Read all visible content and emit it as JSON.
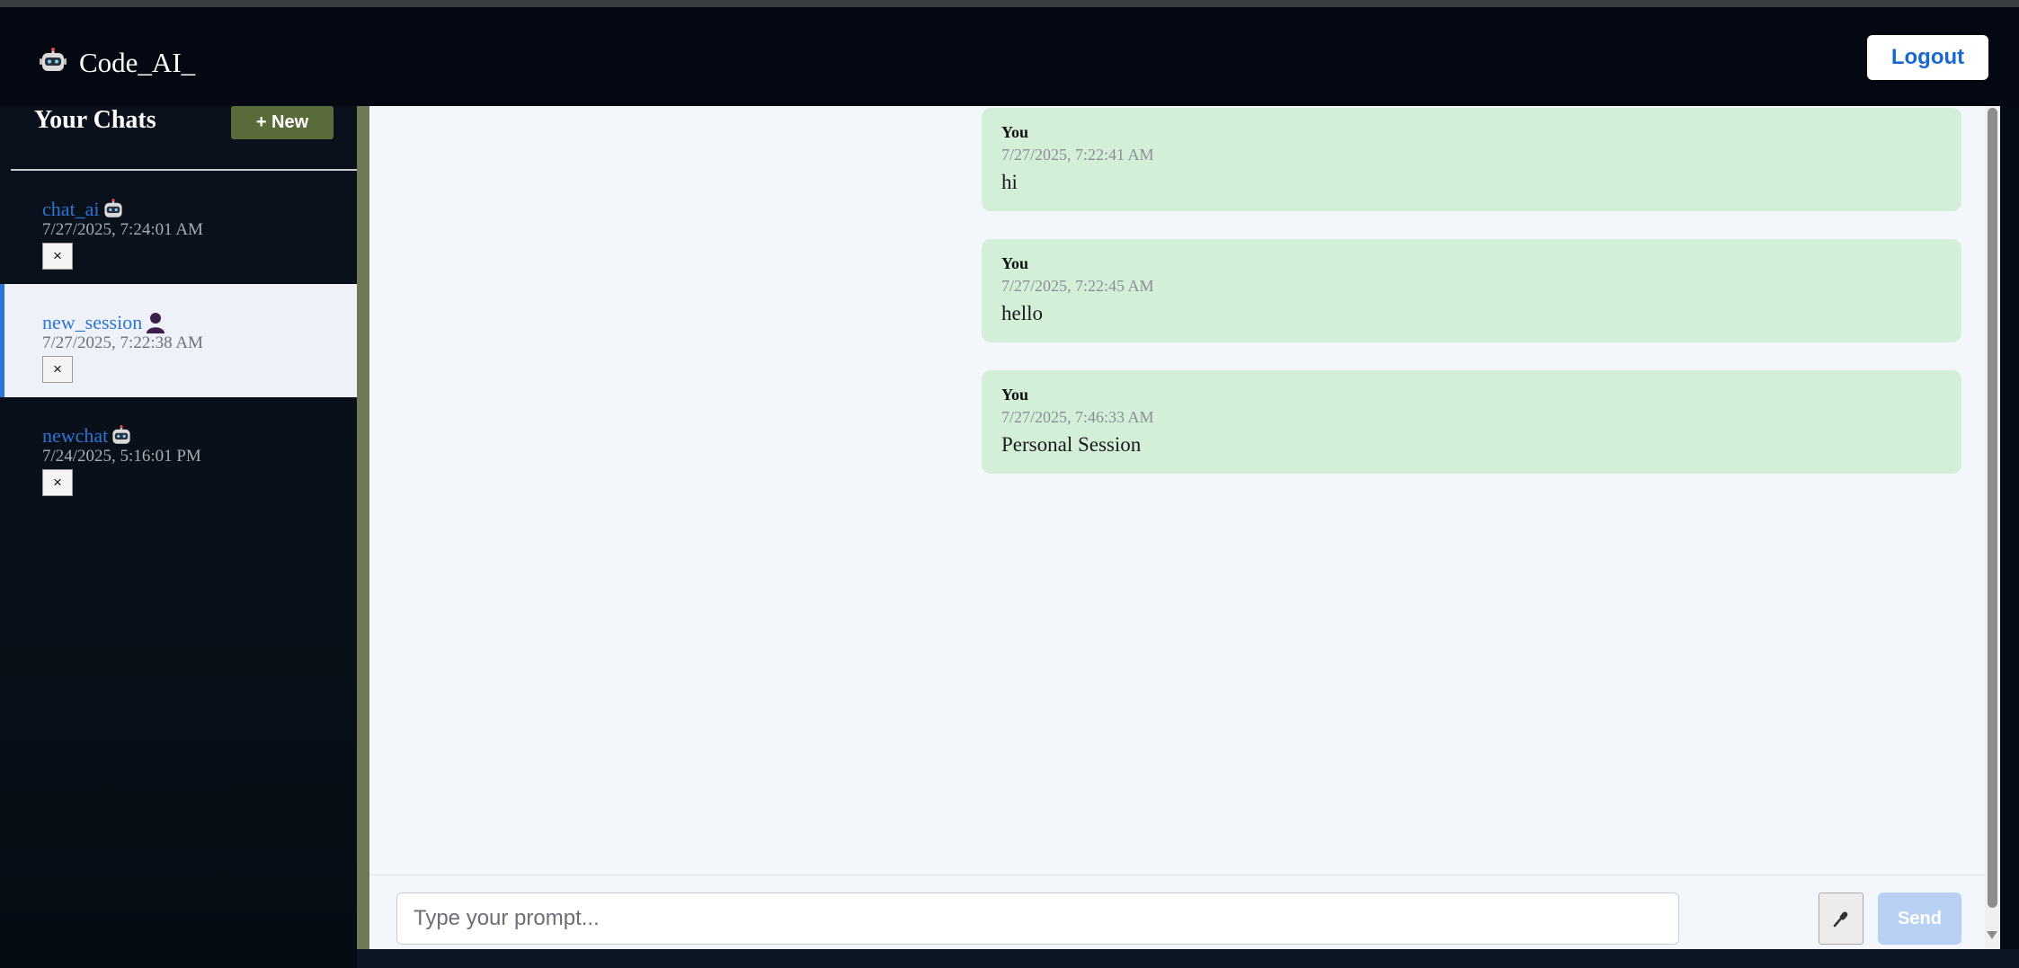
{
  "header": {
    "brand_icon": "robot-icon",
    "brand_text": "Code_AI_",
    "logout_label": "Logout"
  },
  "sidebar": {
    "title": "Your Chats",
    "new_label": "+ New",
    "items": [
      {
        "name": "chat_ai",
        "icon": "robot-icon",
        "time": "7/27/2025, 7:24:01 AM",
        "close": "×",
        "active": false
      },
      {
        "name": "new_session",
        "icon": "person-icon",
        "time": "7/27/2025, 7:22:38 AM",
        "close": "×",
        "active": true
      },
      {
        "name": "newchat",
        "icon": "robot-icon",
        "time": "7/24/2025, 5:16:01 PM",
        "close": "×",
        "active": false
      }
    ]
  },
  "messages": [
    {
      "author": "You",
      "time": "7/27/2025, 7:22:41 AM",
      "text": "hi"
    },
    {
      "author": "You",
      "time": "7/27/2025, 7:22:45 AM",
      "text": "hello"
    },
    {
      "author": "You",
      "time": "7/27/2025, 7:46:33 AM",
      "text": "Personal Session"
    }
  ],
  "composer": {
    "placeholder": "Type your prompt...",
    "value": "",
    "mic_icon": "microphone-icon",
    "send_label": "Send"
  },
  "colors": {
    "accent": "#2c74d6",
    "new_button": "#5a6b3a",
    "message_bg": "#d3efd8",
    "send_disabled": "#b8d1f3"
  }
}
